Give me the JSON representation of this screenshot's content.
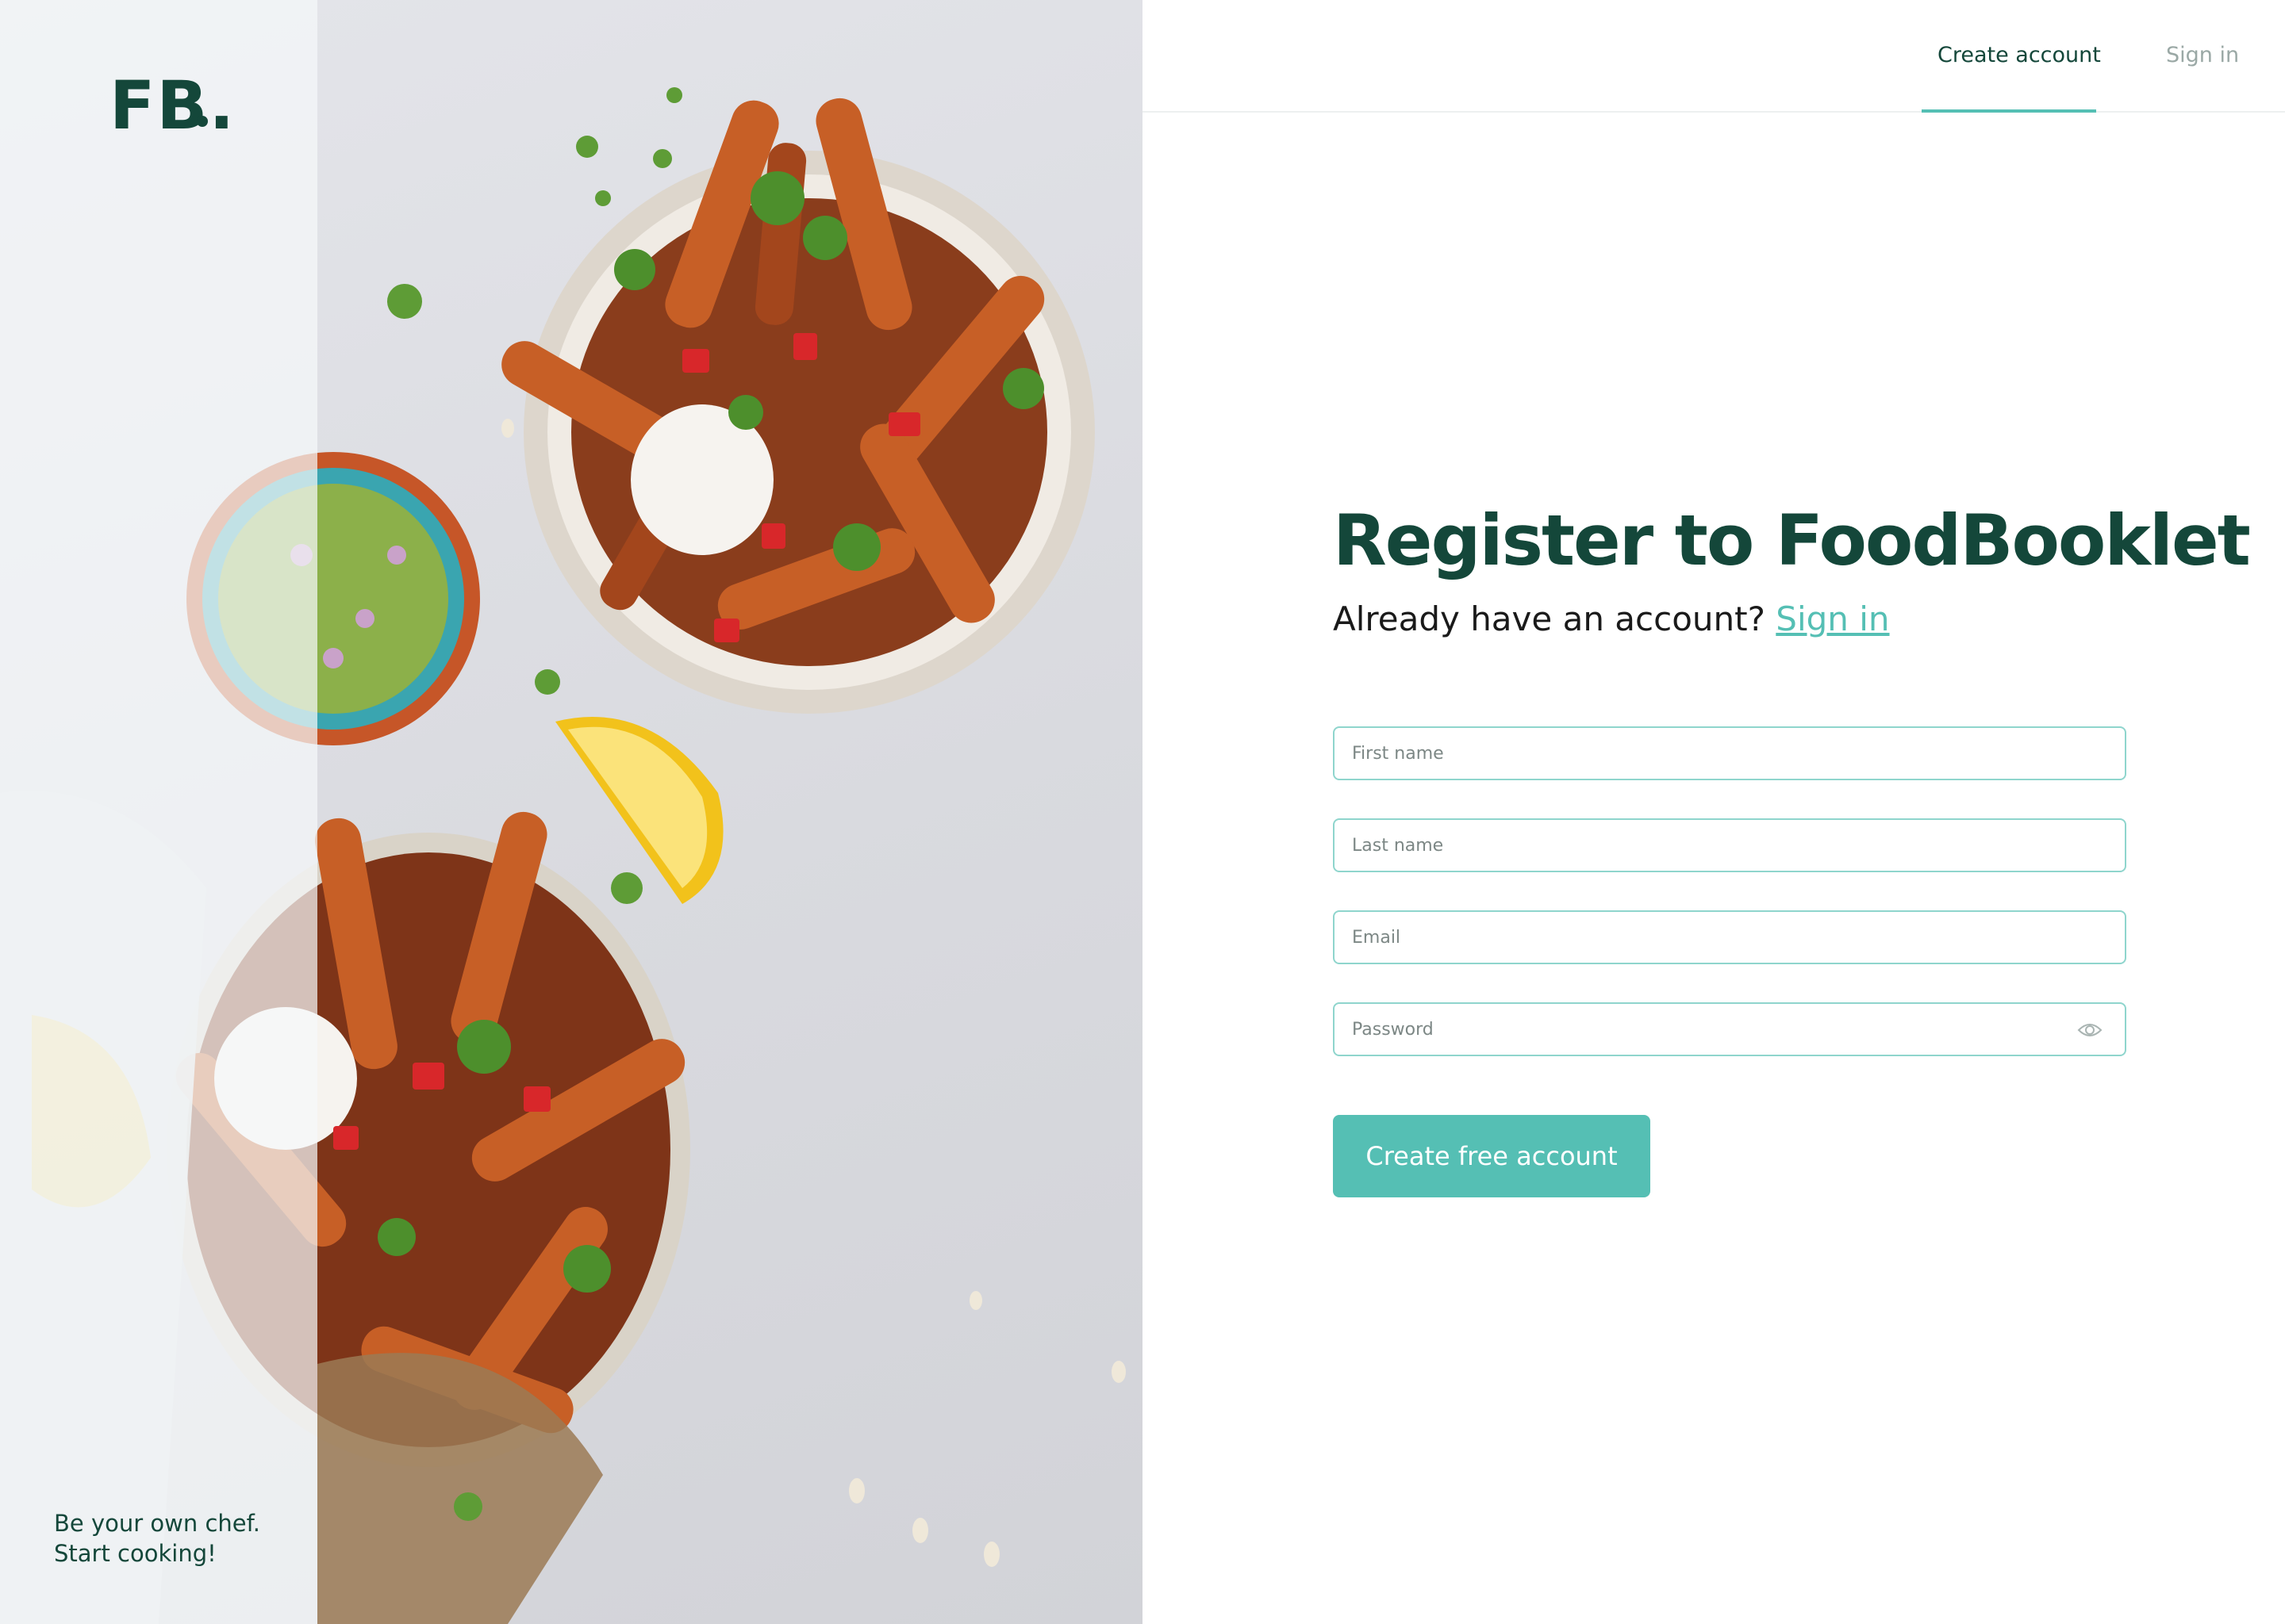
{
  "brand": {
    "logo": "FB.",
    "tagline_line1": "Be your own chef.",
    "tagline_line2": "Start cooking!"
  },
  "nav": {
    "tabs": [
      {
        "label": "Create account",
        "active": true
      },
      {
        "label": "Sign in",
        "active": false
      }
    ]
  },
  "form": {
    "heading": "Register to FoodBooklet",
    "subline_text": "Already have an account?",
    "subline_link": "Sign in",
    "fields": [
      {
        "placeholder": "First name",
        "value": ""
      },
      {
        "placeholder": "Last name",
        "value": ""
      },
      {
        "placeholder": "Email",
        "value": ""
      },
      {
        "placeholder": "Password",
        "value": "",
        "icon": "eye-icon"
      }
    ],
    "submit_label": "Create free account"
  },
  "colors": {
    "primary_dark": "#14473a",
    "accent": "#55bfb4",
    "field_border": "#8fd5cd",
    "muted_text": "#9aa8a5"
  },
  "icons": [
    "eye-icon",
    "logo-mark"
  ]
}
